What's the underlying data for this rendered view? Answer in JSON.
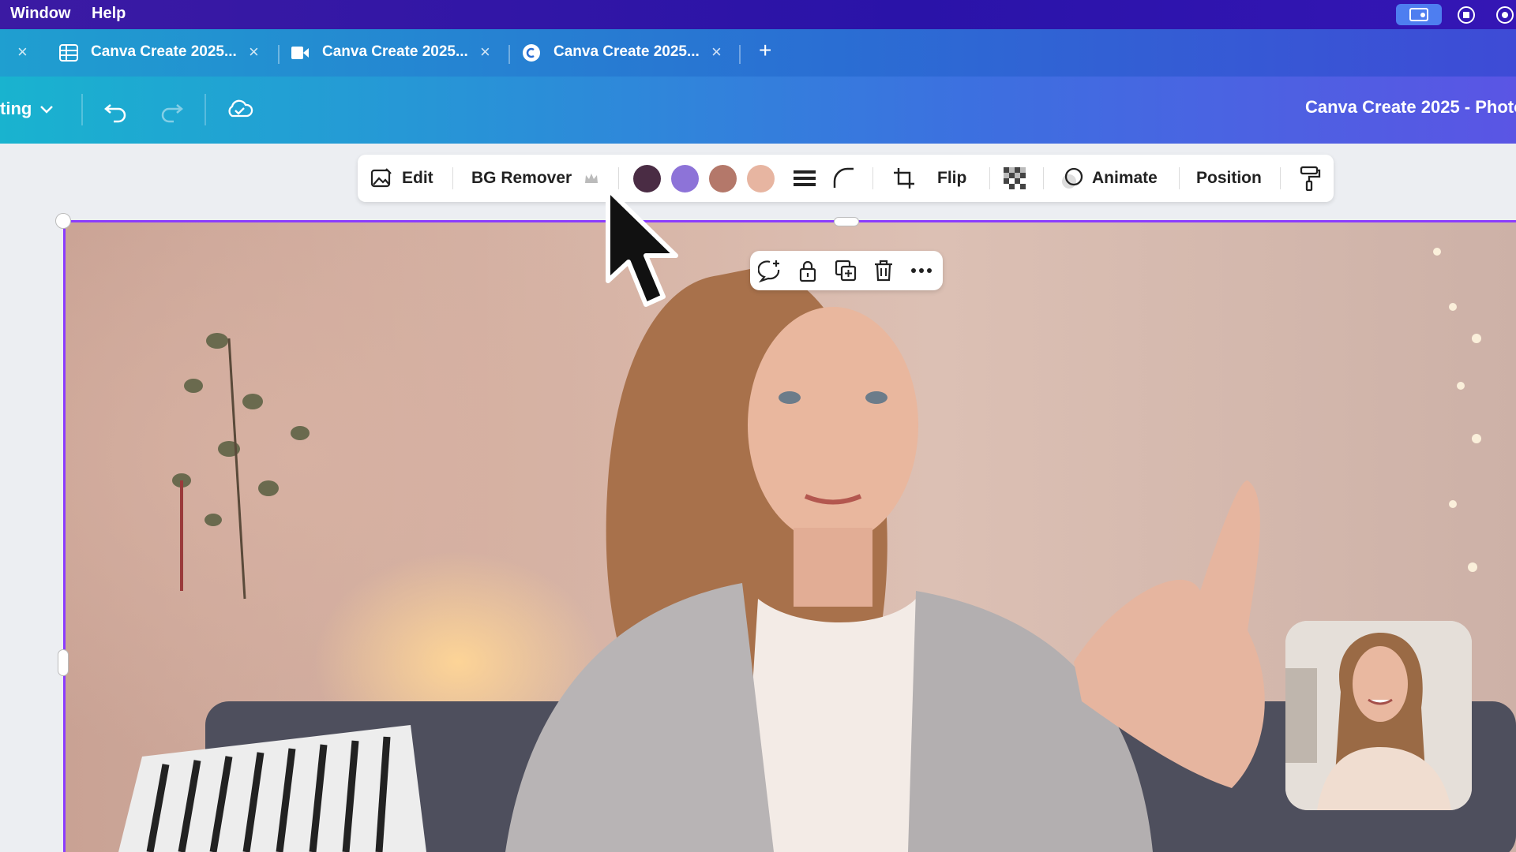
{
  "menubar": {
    "items": [
      "Window",
      "Help"
    ],
    "status_icons": [
      "screen-share-icon",
      "record-icon",
      "control-center-icon"
    ]
  },
  "tabs": [
    {
      "label": "Canva Create 2025...",
      "icon": "sheet-icon"
    },
    {
      "label": "Canva Create 2025...",
      "icon": "video-icon"
    },
    {
      "label": "Canva Create 2025...",
      "icon": "canva-logo-icon"
    }
  ],
  "tab_close_glyph": "×",
  "new_tab_glyph": "+",
  "header": {
    "mode_label": "ting",
    "doc_title": "Canva Create 2025 - Photo"
  },
  "toolbar": {
    "edit_label": "Edit",
    "bg_remover_label": "BG Remover",
    "flip_label": "Flip",
    "animate_label": "Animate",
    "position_label": "Position",
    "swatches": [
      "#4a2c44",
      "#8d73d8",
      "#b4786a",
      "#e7b5a1"
    ]
  },
  "colors": {
    "selection": "#8b3dff",
    "accent_gradient_start": "#19b3cf",
    "accent_gradient_end": "#5a55e4"
  }
}
